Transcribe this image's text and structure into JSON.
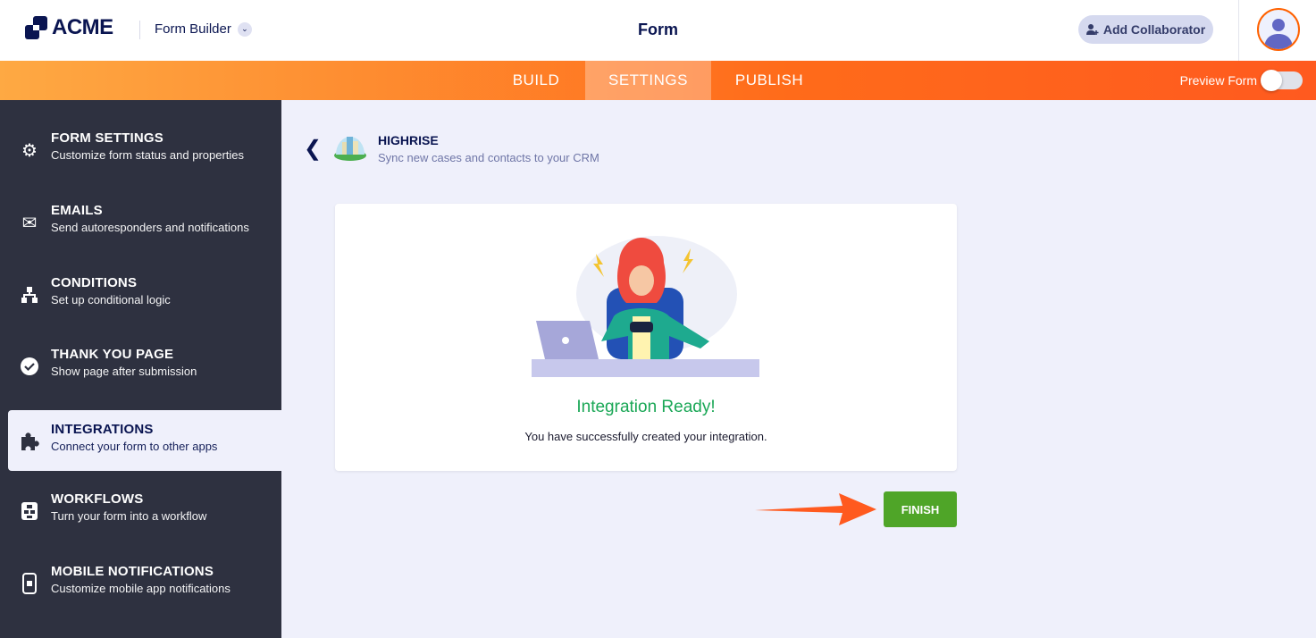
{
  "header": {
    "logo": "ACME",
    "app_name": "Form Builder",
    "title": "Form",
    "add_collaborator": "Add Collaborator"
  },
  "nav": {
    "tabs": [
      "BUILD",
      "SETTINGS",
      "PUBLISH"
    ],
    "active": "SETTINGS",
    "preview_label": "Preview Form",
    "preview_on": false
  },
  "sidebar": {
    "items": [
      {
        "title": "FORM SETTINGS",
        "subtitle": "Customize form status and properties",
        "icon": "gear-icon"
      },
      {
        "title": "EMAILS",
        "subtitle": "Send autoresponders and notifications",
        "icon": "envelope-icon"
      },
      {
        "title": "CONDITIONS",
        "subtitle": "Set up conditional logic",
        "icon": "hierarchy-icon"
      },
      {
        "title": "THANK YOU PAGE",
        "subtitle": "Show page after submission",
        "icon": "check-circle-icon"
      },
      {
        "title": "INTEGRATIONS",
        "subtitle": "Connect your form to other apps",
        "icon": "puzzle-icon"
      },
      {
        "title": "WORKFLOWS",
        "subtitle": "Turn your form into a workflow",
        "icon": "workflow-icon"
      },
      {
        "title": "MOBILE NOTIFICATIONS",
        "subtitle": "Customize mobile app notifications",
        "icon": "mobile-icon"
      }
    ],
    "active": 4
  },
  "integration": {
    "name": "HIGHRISE",
    "description": "Sync new cases and contacts to your CRM"
  },
  "card": {
    "heading": "Integration Ready!",
    "message": "You have successfully created your integration."
  },
  "finish_label": "FINISH",
  "colors": {
    "accent": "#ff6100",
    "success": "#1aa756",
    "finish": "#4fa528"
  }
}
